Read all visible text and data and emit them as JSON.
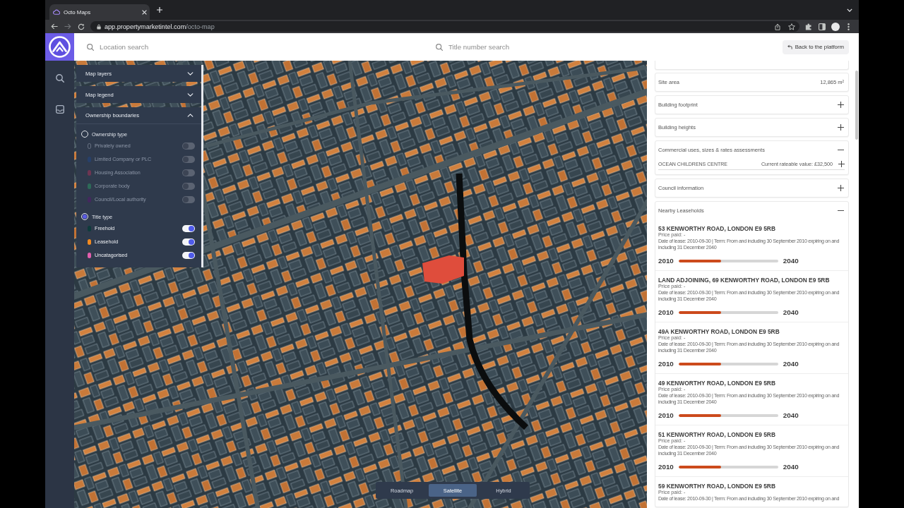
{
  "browser": {
    "tab_title": "Octo Maps",
    "url_host": "app.propertymarketintel.com",
    "url_path": "/octo-map"
  },
  "header": {
    "location_search": {
      "placeholder": "Location search"
    },
    "title_search": {
      "placeholder": "Title number search"
    },
    "back_button": "Back to the platform"
  },
  "layers_panel": {
    "sections": [
      {
        "title": "Map layers",
        "expanded": false
      },
      {
        "title": "Map legend",
        "expanded": false
      },
      {
        "title": "Ownership boundaries",
        "expanded": true,
        "groups": [
          {
            "label": "Ownership type",
            "selected": false,
            "items": [
              {
                "kind": "outline",
                "label": "Privately owned",
                "on": false
              },
              {
                "kind": "fill",
                "label": "Limited Company or PLC",
                "color": "#27406a",
                "on": false
              },
              {
                "kind": "fill",
                "label": "Housing Association",
                "color": "#6e3552",
                "on": false
              },
              {
                "kind": "fill",
                "label": "Corporate body",
                "color": "#2d6a58",
                "on": false
              },
              {
                "kind": "fill",
                "label": "Council/Local authority",
                "color": "#44285e",
                "on": false
              }
            ]
          },
          {
            "label": "Title type",
            "selected": true,
            "items": [
              {
                "kind": "fill",
                "label": "Freehold",
                "color": "#0e3b3b",
                "on": true
              },
              {
                "kind": "fill",
                "label": "Leasehold",
                "color": "#f28a1f",
                "on": true
              },
              {
                "kind": "fill",
                "label": "Uncatagorised",
                "color": "#e35fae",
                "on": true
              }
            ]
          }
        ]
      }
    ]
  },
  "map": {
    "view_options": [
      {
        "label": "Roadmap",
        "selected": false
      },
      {
        "label": "Satellite",
        "selected": true
      },
      {
        "label": "Hybrid",
        "selected": false
      }
    ]
  },
  "details": {
    "site_area": {
      "label": "Site area",
      "value": "12,865 m²"
    },
    "sections": [
      {
        "title": "Building footprint",
        "expanded": false
      },
      {
        "title": "Building heights",
        "expanded": false
      },
      {
        "title": "Commercial uses, sizes & rates assessments",
        "expanded": true,
        "entries": [
          {
            "name": "OCEAN CHILDRENS CENTRE",
            "value": "Current rateable value: £32,500",
            "expanded": false
          }
        ]
      },
      {
        "title": "Council information",
        "expanded": false
      },
      {
        "title": "Nearby Leaseholds",
        "expanded": true,
        "leaseholds": [
          {
            "address": "53 KENWORTHY ROAD, LONDON E9 5RB",
            "price": "Price paid: -",
            "terms": "Date of lease: 2010-09-30 | Term: From and including 30 September 2010 expiring on and including 31 December 2040",
            "start": "2010",
            "end": "2040",
            "level": 0.43
          },
          {
            "address": "LAND ADJOINING, 69 KENWORTHY ROAD, LONDON E9 5RB",
            "price": "Price paid: -",
            "terms": "Date of lease: 2010-09-30 | Term: From and including 30 September 2010 expiring on and including 31 December 2040",
            "start": "2010",
            "end": "2040",
            "level": 0.43
          },
          {
            "address": "49A KENWORTHY ROAD, LONDON E9 5RB",
            "price": "Price paid: -",
            "terms": "Date of lease: 2010-09-30 | Term: From and including 30 September 2010 expiring on and including 31 December 2040",
            "start": "2010",
            "end": "2040",
            "level": 0.43
          },
          {
            "address": "49 KENWORTHY ROAD, LONDON E9 5RB",
            "price": "Price paid: -",
            "terms": "Date of lease: 2010-09-30 | Term: From and including 30 September 2010 expiring on and including 31 December 2040",
            "start": "2010",
            "end": "2040",
            "level": 0.43
          },
          {
            "address": "51 KENWORTHY ROAD, LONDON E9 5RB",
            "price": "Price paid: -",
            "terms": "Date of lease: 2010-09-30 | Term: From and including 30 September 2010 expiring on and including 31 December 2040",
            "start": "2010",
            "end": "2040",
            "level": 0.43
          },
          {
            "address": "59 KENWORTHY ROAD, LONDON E9 5RB",
            "price": "Price paid: -",
            "terms": "Date of lease: 2010-09-30 | Term: From and including 30 September 2010 expiring on and"
          }
        ]
      }
    ]
  }
}
